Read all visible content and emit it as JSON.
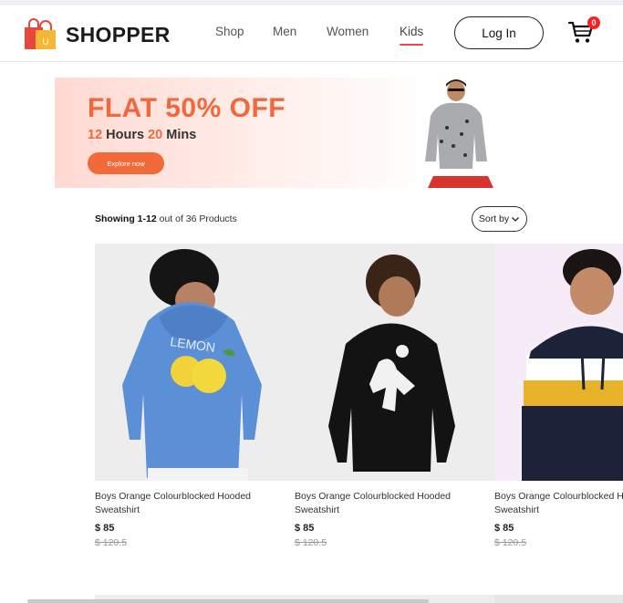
{
  "brand": {
    "name": "SHOPPER",
    "logo_letter": "U"
  },
  "nav": [
    {
      "label": "Shop",
      "active": false
    },
    {
      "label": "Men",
      "active": false
    },
    {
      "label": "Women",
      "active": false
    },
    {
      "label": "Kids",
      "active": true
    }
  ],
  "header": {
    "login_label": "Log In",
    "cart_count": "0",
    "cart_icon": "cart-icon"
  },
  "banner": {
    "title": "FLAT 50% OFF",
    "hours": "12",
    "hours_label": "Hours",
    "mins": "20",
    "mins_label": "Mins",
    "cta": "Explore now",
    "accent": "#f1683a"
  },
  "listing": {
    "showing_range": "Showing 1-12",
    "showing_rest": "out of 36 Products",
    "sort_label": "Sort by"
  },
  "products": [
    {
      "name": "Boys Orange Colourblocked Hooded Sweatshirt",
      "price": "$ 85",
      "old_price": "$ 120.5"
    },
    {
      "name": "Boys Orange Colourblocked Hooded Sweatshirt",
      "price": "$ 85",
      "old_price": "$ 120.5"
    },
    {
      "name": "Boys Orange Colourblocked Hooded Sweatshirt",
      "price": "$ 85",
      "old_price": "$ 120.5"
    }
  ]
}
